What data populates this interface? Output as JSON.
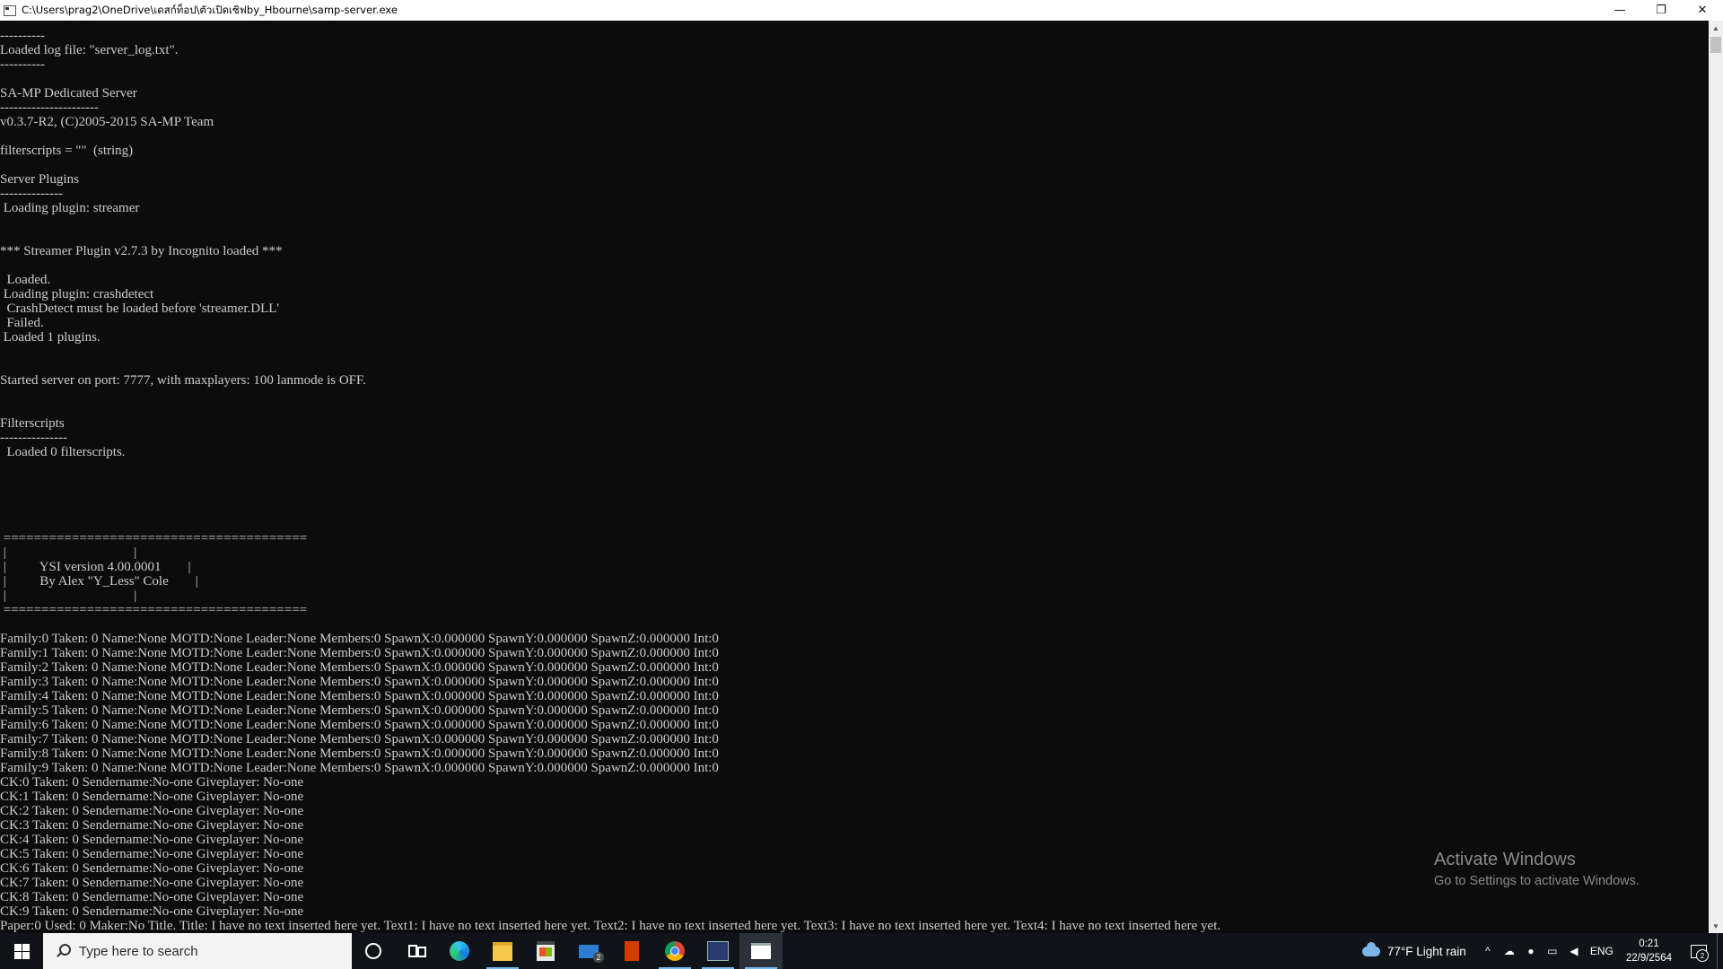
{
  "window": {
    "title": "C:\\Users\\prag2\\OneDrive\\เดสก์ท็อป\\ตัวเปิดเซิฟby_Hbourne\\samp-server.exe",
    "minimize": "—",
    "maximize": "❐",
    "close": "✕"
  },
  "console": {
    "lines": [
      "----------",
      "Loaded log file: \"server_log.txt\".",
      "----------",
      "",
      "SA-MP Dedicated Server",
      "----------------------",
      "v0.3.7-R2, (C)2005-2015 SA-MP Team",
      "",
      "filterscripts = \"\"  (string)",
      "",
      "Server Plugins",
      "--------------",
      " Loading plugin: streamer",
      "",
      "",
      "*** Streamer Plugin v2.7.3 by Incognito loaded ***",
      "",
      "  Loaded.",
      " Loading plugin: crashdetect",
      "  CrashDetect must be loaded before 'streamer.DLL'",
      "  Failed.",
      " Loaded 1 plugins.",
      "",
      "",
      "Started server on port: 7777, with maxplayers: 100 lanmode is OFF.",
      "",
      "",
      "Filterscripts",
      "---------------",
      "  Loaded 0 filterscripts.",
      "",
      "",
      "",
      "",
      "",
      " ========================================",
      " |                                      |",
      " |          YSI version 4.00.0001        |",
      " |          By Alex \"Y_Less\" Cole        |",
      " |                                      |",
      " ========================================",
      "",
      "Family:0 Taken: 0 Name:None MOTD:None Leader:None Members:0 SpawnX:0.000000 SpawnY:0.000000 SpawnZ:0.000000 Int:0",
      "Family:1 Taken: 0 Name:None MOTD:None Leader:None Members:0 SpawnX:0.000000 SpawnY:0.000000 SpawnZ:0.000000 Int:0",
      "Family:2 Taken: 0 Name:None MOTD:None Leader:None Members:0 SpawnX:0.000000 SpawnY:0.000000 SpawnZ:0.000000 Int:0",
      "Family:3 Taken: 0 Name:None MOTD:None Leader:None Members:0 SpawnX:0.000000 SpawnY:0.000000 SpawnZ:0.000000 Int:0",
      "Family:4 Taken: 0 Name:None MOTD:None Leader:None Members:0 SpawnX:0.000000 SpawnY:0.000000 SpawnZ:0.000000 Int:0",
      "Family:5 Taken: 0 Name:None MOTD:None Leader:None Members:0 SpawnX:0.000000 SpawnY:0.000000 SpawnZ:0.000000 Int:0",
      "Family:6 Taken: 0 Name:None MOTD:None Leader:None Members:0 SpawnX:0.000000 SpawnY:0.000000 SpawnZ:0.000000 Int:0",
      "Family:7 Taken: 0 Name:None MOTD:None Leader:None Members:0 SpawnX:0.000000 SpawnY:0.000000 SpawnZ:0.000000 Int:0",
      "Family:8 Taken: 0 Name:None MOTD:None Leader:None Members:0 SpawnX:0.000000 SpawnY:0.000000 SpawnZ:0.000000 Int:0",
      "Family:9 Taken: 0 Name:None MOTD:None Leader:None Members:0 SpawnX:0.000000 SpawnY:0.000000 SpawnZ:0.000000 Int:0",
      "CK:0 Taken: 0 Sendername:No-one Giveplayer: No-one",
      "CK:1 Taken: 0 Sendername:No-one Giveplayer: No-one",
      "CK:2 Taken: 0 Sendername:No-one Giveplayer: No-one",
      "CK:3 Taken: 0 Sendername:No-one Giveplayer: No-one",
      "CK:4 Taken: 0 Sendername:No-one Giveplayer: No-one",
      "CK:5 Taken: 0 Sendername:No-one Giveplayer: No-one",
      "CK:6 Taken: 0 Sendername:No-one Giveplayer: No-one",
      "CK:7 Taken: 0 Sendername:No-one Giveplayer: No-one",
      "CK:8 Taken: 0 Sendername:No-one Giveplayer: No-one",
      "CK:9 Taken: 0 Sendername:No-one Giveplayer: No-one",
      "Paper:0 Used: 0 Maker:No Title. Title: I have no text inserted here yet. Text1: I have no text inserted here yet. Text2: I have no text inserted here yet. Text3: I have no text inserted here yet. Text4: I have no text inserted here yet."
    ]
  },
  "watermark": {
    "title": "Activate Windows",
    "subtitle": "Go to Settings to activate Windows."
  },
  "taskbar": {
    "search_placeholder": "Type here to search",
    "mail_badge": "2",
    "weather": "77°F  Light rain",
    "language": "ENG",
    "time": "0:21",
    "date": "22/9/2564",
    "notification_count": "2",
    "pinned_icons": [
      "cortana-icon",
      "task-view-icon",
      "edge-icon",
      "file-explorer-icon",
      "store-icon",
      "mail-icon",
      "office-icon",
      "chrome-icon",
      "samp-icon",
      "console-icon"
    ]
  },
  "colors": {
    "console_bg": "#0c0c0c",
    "console_text": "#cccccc",
    "taskbar_bg": "#101318",
    "accent": "#76b9ed"
  }
}
